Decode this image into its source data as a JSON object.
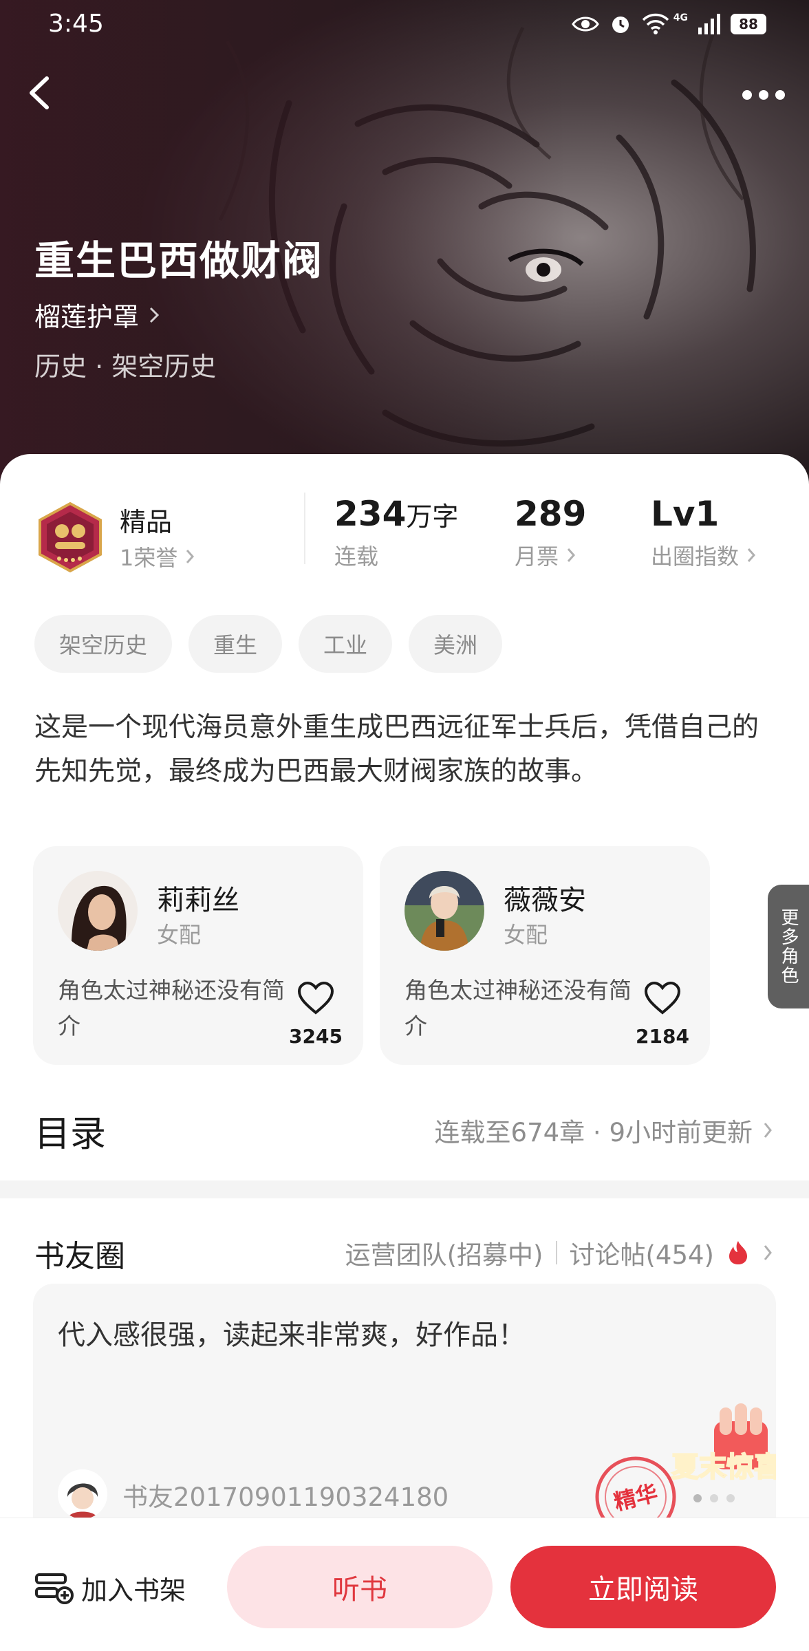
{
  "status_bar": {
    "time": "3:45",
    "network": "4G",
    "battery": "88"
  },
  "book": {
    "title": "重生巴西做财阀",
    "author": "榴莲护罩",
    "genre": "历史 · 架空历史"
  },
  "stats": {
    "quality": {
      "title": "精品",
      "honor": "1荣誉"
    },
    "words": {
      "value": "234",
      "unit": "万字",
      "label": "连载"
    },
    "monthly_votes": {
      "value": "289",
      "label": "月票"
    },
    "index": {
      "value": "Lv1",
      "label": "出圈指数"
    }
  },
  "tags": [
    "架空历史",
    "重生",
    "工业",
    "美洲"
  ],
  "synopsis": "这是一个现代海员意外重生成巴西远征军士兵后，凭借自己的先知先觉，最终成为巴西最大财阀家族的故事。",
  "characters": [
    {
      "name": "莉莉丝",
      "role": "女配",
      "desc": "角色太过神秘还没有简介",
      "likes": "3245"
    },
    {
      "name": "薇薇安",
      "role": "女配",
      "desc": "角色太过神秘还没有简介",
      "likes": "2184"
    }
  ],
  "more_roles": "更多角色",
  "toc": {
    "title": "目录",
    "info": "连载至674章 · 9小时前更新"
  },
  "circle": {
    "title": "书友圈",
    "ops_team": "运营团队(招募中)",
    "discussion": "讨论帖(454)",
    "post": {
      "text": "代入感很强，读起来非常爽，好作品！",
      "user": "书友20170901190324180"
    },
    "stamp_text": "精华",
    "promo_text": "夏末惊喜"
  },
  "bottom_bar": {
    "add_shelf": "加入书架",
    "listen": "听书",
    "read": "立即阅读"
  },
  "colors": {
    "primary_red": "#e4323d",
    "light_red": "#fde3e6"
  }
}
